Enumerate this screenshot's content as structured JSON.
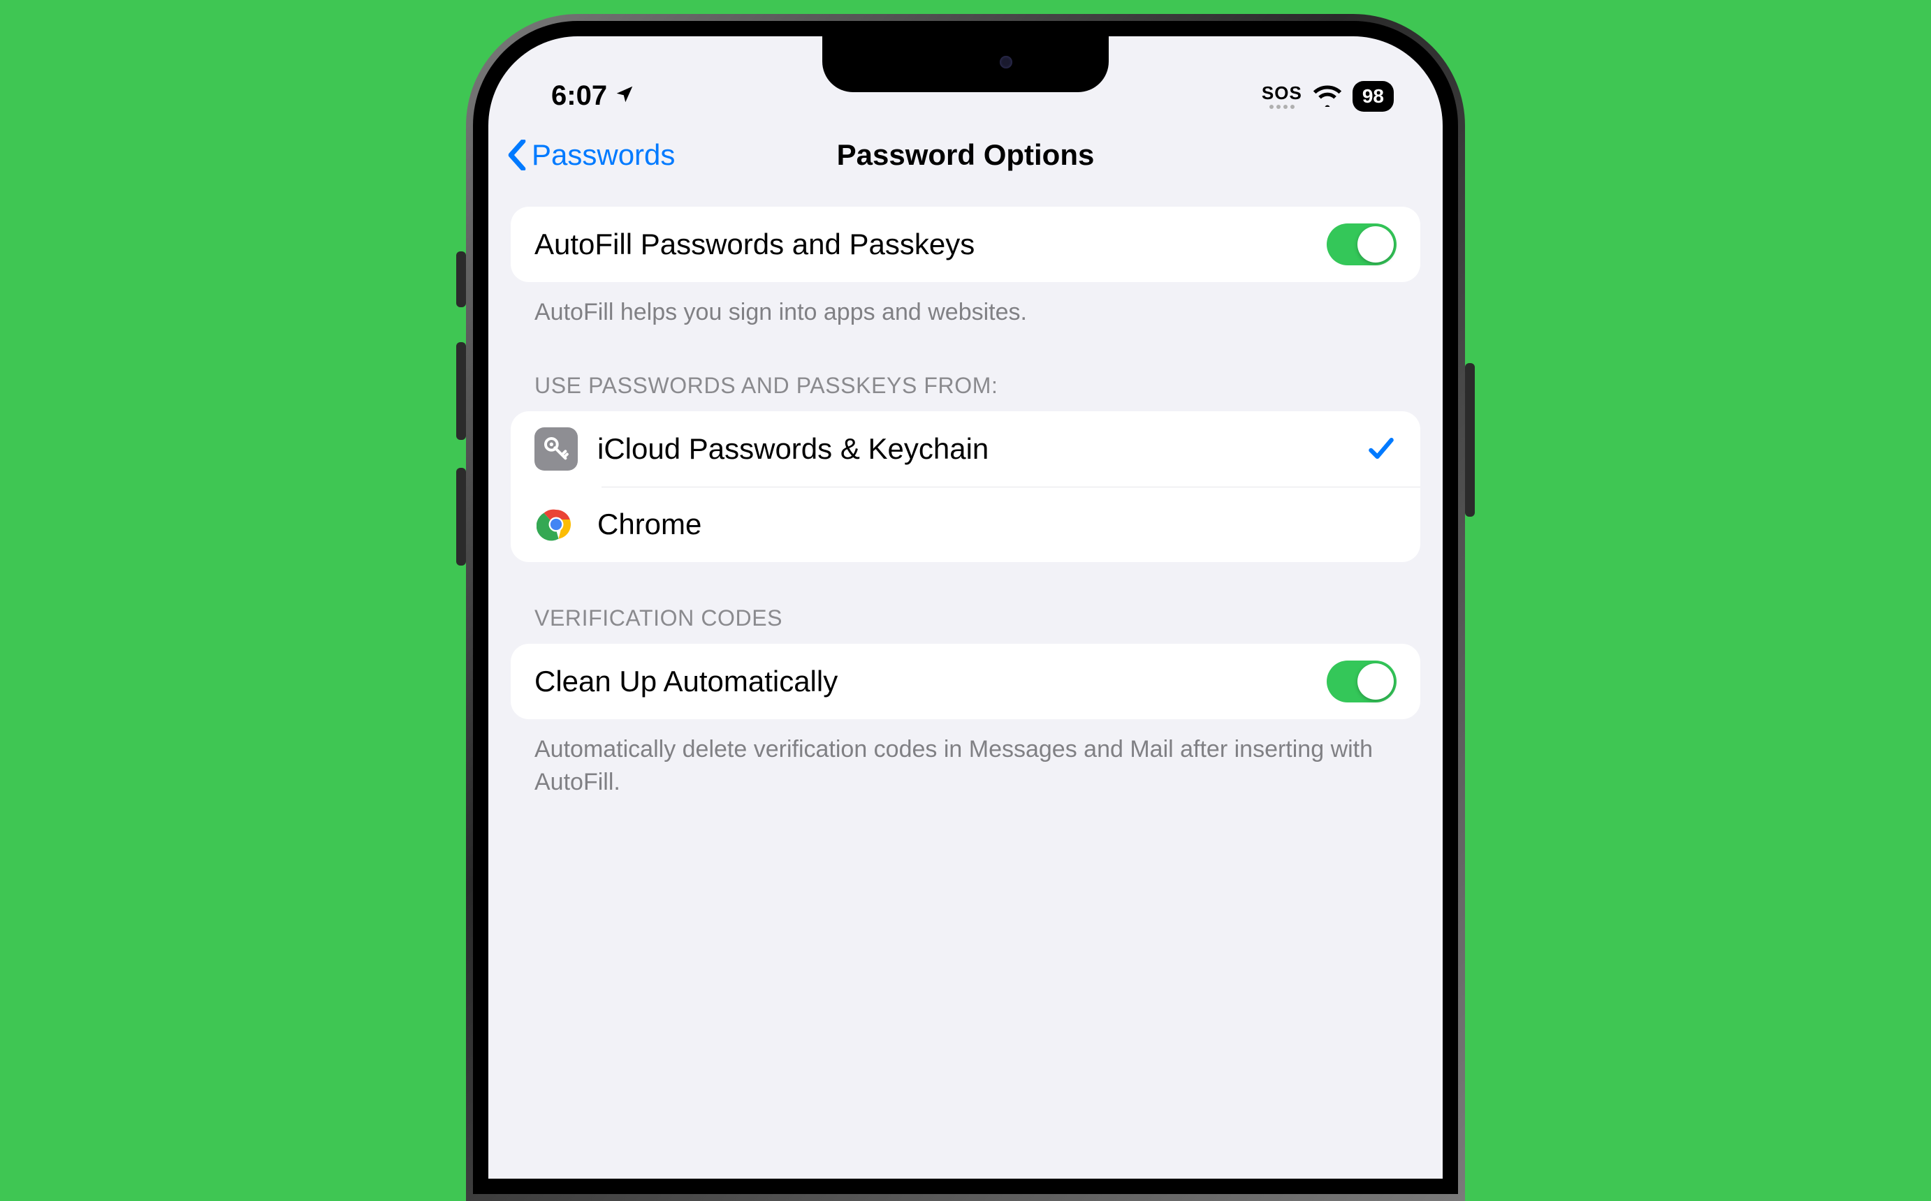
{
  "status": {
    "time": "6:07",
    "sos": "SOS",
    "battery": "98"
  },
  "nav": {
    "back_label": "Passwords",
    "title": "Password Options"
  },
  "autofill": {
    "label": "AutoFill Passwords and Passkeys",
    "enabled": true,
    "footer": "AutoFill helps you sign into apps and websites."
  },
  "providers": {
    "header": "USE PASSWORDS AND PASSKEYS FROM:",
    "items": [
      {
        "label": "iCloud Passwords & Keychain",
        "icon": "keychain",
        "selected": true
      },
      {
        "label": "Chrome",
        "icon": "chrome",
        "selected": false
      }
    ]
  },
  "verification": {
    "header": "VERIFICATION CODES",
    "cleanup_label": "Clean Up Automatically",
    "cleanup_enabled": true,
    "footer": "Automatically delete verification codes in Messages and Mail after inserting with AutoFill."
  }
}
